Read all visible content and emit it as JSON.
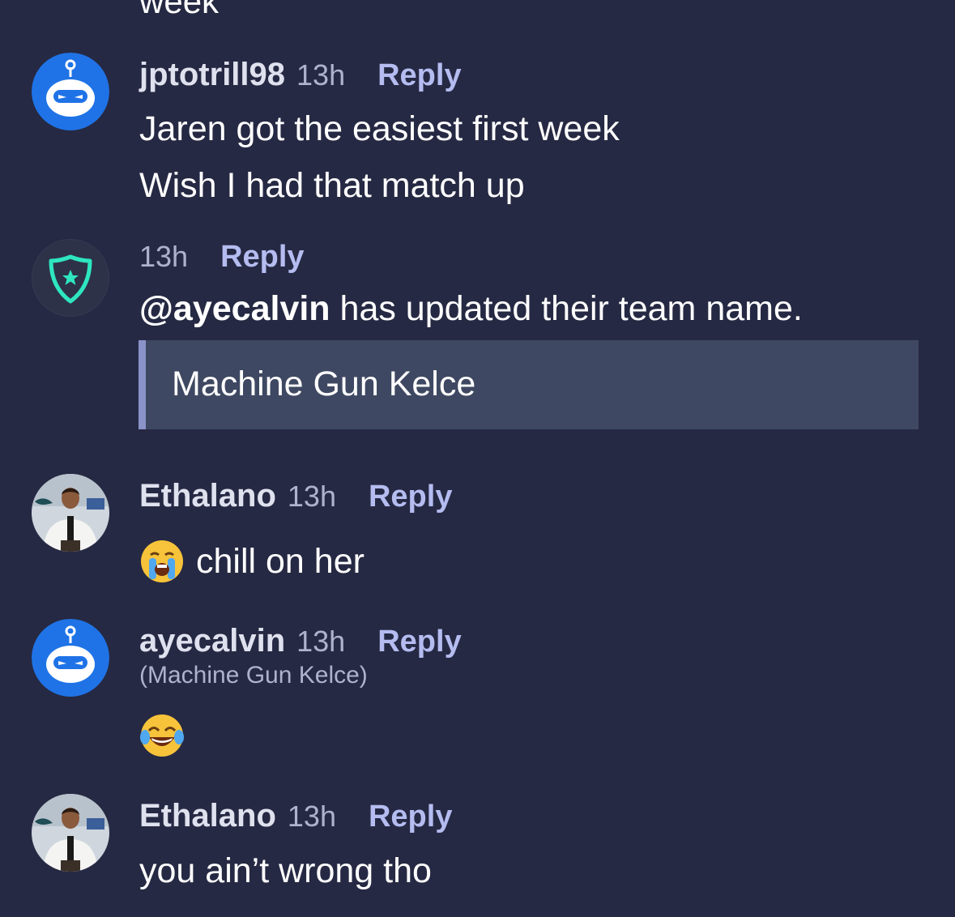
{
  "top_fragment": "week",
  "comments": [
    {
      "username": "jptotrill98",
      "time": "13h",
      "reply": "Reply",
      "lines": [
        "Jaren got the easiest first week",
        "Wish I had that match up"
      ]
    },
    {
      "time": "13h",
      "reply": "Reply",
      "mention": "@ayecalvin",
      "message": "has updated their team name.",
      "quote": "Machine Gun Kelce"
    },
    {
      "username": "Ethalano",
      "time": "13h",
      "reply": "Reply",
      "text": "chill on her",
      "emoji": "loudly-crying-face"
    },
    {
      "username": "ayecalvin",
      "time": "13h",
      "reply": "Reply",
      "team_name": "(Machine Gun Kelce)",
      "emoji": "face-with-tears-of-joy"
    },
    {
      "username": "Ethalano",
      "time": "13h",
      "reply": "Reply",
      "text": "you ain’t wrong tho"
    }
  ],
  "colors": {
    "background": "#262943",
    "reply": "#b4bcf0",
    "robot_avatar": "#1f73e6",
    "system_badge": "#2ee6c0",
    "quote_bg": "#3f4862"
  }
}
